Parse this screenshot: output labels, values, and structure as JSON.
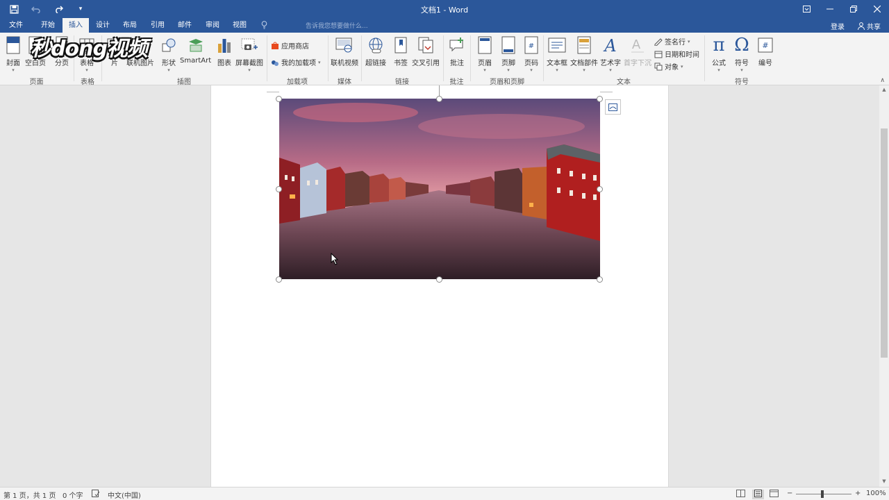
{
  "window": {
    "title": "文档1 - Word"
  },
  "qat": {
    "save_icon": "save-icon",
    "undo_icon": "undo-icon",
    "redo_icon": "redo-icon",
    "customize": "▾"
  },
  "tabs": [
    "文件",
    "开始",
    "插入",
    "设计",
    "布局",
    "引用",
    "邮件",
    "审阅",
    "视图"
  ],
  "active_tab": "插入",
  "tell_me": "告诉我您想要做什么...",
  "account": {
    "login": "登录",
    "share": "共享"
  },
  "ribbon": {
    "pages": {
      "cover": "封面",
      "blank": "空白页",
      "break": "分页"
    },
    "tables": {
      "table": "表格"
    },
    "illustrations": {
      "picture": "片",
      "online_picture": "联机图片",
      "shapes": "形状",
      "smartart": "SmartArt",
      "chart": "图表",
      "screenshot": "屏幕截图"
    },
    "addins": {
      "store": "应用商店",
      "my_addins": "我的加载项"
    },
    "media": {
      "online_video": "联机视频"
    },
    "links": {
      "hyperlink": "超链接",
      "bookmark": "书签",
      "cross_ref": "交叉引用"
    },
    "comments": {
      "comment": "批注"
    },
    "header_footer": {
      "header": "页眉",
      "footer": "页脚",
      "page_number": "页码"
    },
    "text": {
      "textbox": "文本框",
      "quick_parts": "文档部件",
      "wordart": "艺术字",
      "dropcap": "首字下沉",
      "signature": "签名行",
      "datetime": "日期和时间",
      "object": "对象"
    },
    "symbols": {
      "equation": "公式",
      "symbol": "符号",
      "number": "编号"
    },
    "groups": {
      "pages": "页面",
      "tables": "表格",
      "illustrations": "插图",
      "addins": "加载项",
      "media": "媒体",
      "links": "链接",
      "comments": "批注",
      "header_footer": "页眉和页脚",
      "text": "文本",
      "symbols": "符号"
    }
  },
  "watermark": "秒dong视频",
  "status": {
    "page": "第 1 页，共 1 页",
    "words": "0 个字",
    "language": "中文(中国)",
    "zoom": "100%"
  },
  "colors": {
    "accent": "#2b579a",
    "ribbon_bg": "#f3f3f3"
  }
}
